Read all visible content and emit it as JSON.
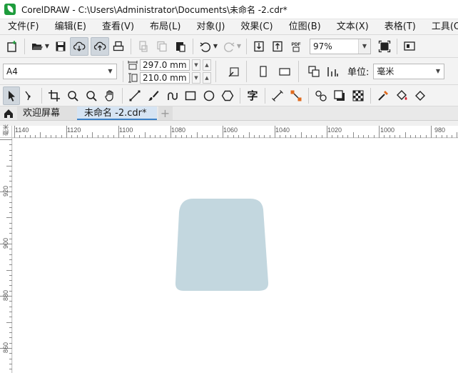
{
  "window": {
    "title": "CorelDRAW - C:\\Users\\Administrator\\Documents\\未命名 -2.cdr*"
  },
  "menu": {
    "items": [
      "文件(F)",
      "编辑(E)",
      "查看(V)",
      "布局(L)",
      "对象(J)",
      "效果(C)",
      "位图(B)",
      "文本(X)",
      "表格(T)",
      "工具(O)"
    ]
  },
  "standard_toolbar": {
    "zoom_value": "97%",
    "pdf_label": "PDF"
  },
  "property_bar": {
    "page_size": "A4",
    "width": "297.0 mm",
    "height": "210.0 mm",
    "unit_label": "单位:",
    "unit_value": "毫米"
  },
  "toolbox": {
    "text_tool_glyph": "字"
  },
  "tabs": {
    "welcome": "欢迎屏幕",
    "document": "未命名 -2.cdr*",
    "add": "+"
  },
  "ruler": {
    "horizontal": [
      "1140",
      "1120",
      "1100",
      "1080",
      "1060",
      "1040",
      "1020",
      "1000",
      "980"
    ],
    "vertical": [
      "920",
      "900",
      "880",
      "860"
    ],
    "corner_label": "毫米"
  },
  "colors": {
    "shape_fill": "#c3d7df",
    "active_tab_accent": "#3c82c8",
    "app_logo": "#1e9c3c"
  }
}
